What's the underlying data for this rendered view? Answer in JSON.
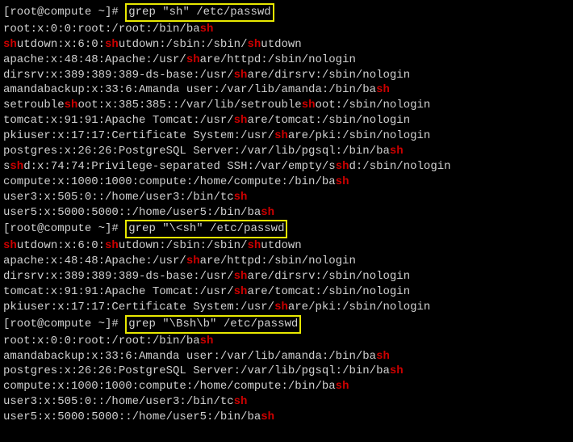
{
  "prompt": "[root@compute ~]# ",
  "commands": {
    "c1": "grep \"sh\" /etc/passwd",
    "c2": "grep \"\\<sh\" /etc/passwd",
    "c3": "grep \"\\Bsh\\b\" /etc/passwd"
  },
  "rows": {
    "r1": [
      {
        "t": "root:x:0:0:root:/root:/bin/ba"
      },
      {
        "t": "sh",
        "h": true
      }
    ],
    "r2": [
      {
        "t": "sh",
        "h": true
      },
      {
        "t": "utdown:x:6:0:"
      },
      {
        "t": "sh",
        "h": true
      },
      {
        "t": "utdown:/sbin:/sbin/"
      },
      {
        "t": "sh",
        "h": true
      },
      {
        "t": "utdown"
      }
    ],
    "r3": [
      {
        "t": "apache:x:48:48:Apache:/usr/"
      },
      {
        "t": "sh",
        "h": true
      },
      {
        "t": "are/httpd:/sbin/nologin"
      }
    ],
    "r4": [
      {
        "t": "dirsrv:x:389:389:389-ds-base:/usr/"
      },
      {
        "t": "sh",
        "h": true
      },
      {
        "t": "are/dirsrv:/sbin/nologin"
      }
    ],
    "r5": [
      {
        "t": "amandabackup:x:33:6:Amanda user:/var/lib/amanda:/bin/ba"
      },
      {
        "t": "sh",
        "h": true
      }
    ],
    "r6": [
      {
        "t": "setrouble"
      },
      {
        "t": "sh",
        "h": true
      },
      {
        "t": "oot:x:385:385::/var/lib/setrouble"
      },
      {
        "t": "sh",
        "h": true
      },
      {
        "t": "oot:/sbin/nologin"
      }
    ],
    "r7": [
      {
        "t": "tomcat:x:91:91:Apache Tomcat:/usr/"
      },
      {
        "t": "sh",
        "h": true
      },
      {
        "t": "are/tomcat:/sbin/nologin"
      }
    ],
    "r8": [
      {
        "t": "pkiuser:x:17:17:Certificate System:/usr/"
      },
      {
        "t": "sh",
        "h": true
      },
      {
        "t": "are/pki:/sbin/nologin"
      }
    ],
    "r9": [
      {
        "t": "postgres:x:26:26:PostgreSQL Server:/var/lib/pgsql:/bin/ba"
      },
      {
        "t": "sh",
        "h": true
      }
    ],
    "r10": [
      {
        "t": "s"
      },
      {
        "t": "sh",
        "h": true
      },
      {
        "t": "d:x:74:74:Privilege-separated SSH:/var/empty/s"
      },
      {
        "t": "sh",
        "h": true
      },
      {
        "t": "d:/sbin/nologin"
      }
    ],
    "r11": [
      {
        "t": "compute:x:1000:1000:compute:/home/compute:/bin/ba"
      },
      {
        "t": "sh",
        "h": true
      }
    ],
    "r12": [
      {
        "t": "user3:x:505:0::/home/user3:/bin/tc"
      },
      {
        "t": "sh",
        "h": true
      }
    ],
    "r13": [
      {
        "t": "user5:x:5000:5000::/home/user5:/bin/ba"
      },
      {
        "t": "sh",
        "h": true
      }
    ],
    "r14": [
      {
        "t": "sh",
        "h": true
      },
      {
        "t": "utdown:x:6:0:"
      },
      {
        "t": "sh",
        "h": true
      },
      {
        "t": "utdown:/sbin:/sbin/"
      },
      {
        "t": "sh",
        "h": true
      },
      {
        "t": "utdown"
      }
    ],
    "r15": [
      {
        "t": "apache:x:48:48:Apache:/usr/"
      },
      {
        "t": "sh",
        "h": true
      },
      {
        "t": "are/httpd:/sbin/nologin"
      }
    ],
    "r16": [
      {
        "t": "dirsrv:x:389:389:389-ds-base:/usr/"
      },
      {
        "t": "sh",
        "h": true
      },
      {
        "t": "are/dirsrv:/sbin/nologin"
      }
    ],
    "r17": [
      {
        "t": "tomcat:x:91:91:Apache Tomcat:/usr/"
      },
      {
        "t": "sh",
        "h": true
      },
      {
        "t": "are/tomcat:/sbin/nologin"
      }
    ],
    "r18": [
      {
        "t": "pkiuser:x:17:17:Certificate System:/usr/"
      },
      {
        "t": "sh",
        "h": true
      },
      {
        "t": "are/pki:/sbin/nologin"
      }
    ],
    "r19": [
      {
        "t": "root:x:0:0:root:/root:/bin/ba"
      },
      {
        "t": "sh",
        "h": true
      }
    ],
    "r20": [
      {
        "t": "amandabackup:x:33:6:Amanda user:/var/lib/amanda:/bin/ba"
      },
      {
        "t": "sh",
        "h": true
      }
    ],
    "r21": [
      {
        "t": "postgres:x:26:26:PostgreSQL Server:/var/lib/pgsql:/bin/ba"
      },
      {
        "t": "sh",
        "h": true
      }
    ],
    "r22": [
      {
        "t": "compute:x:1000:1000:compute:/home/compute:/bin/ba"
      },
      {
        "t": "sh",
        "h": true
      }
    ],
    "r23": [
      {
        "t": "user3:x:505:0::/home/user3:/bin/tc"
      },
      {
        "t": "sh",
        "h": true
      }
    ],
    "r24": [
      {
        "t": "user5:x:5000:5000::/home/user5:/bin/ba"
      },
      {
        "t": "sh",
        "h": true
      }
    ]
  }
}
